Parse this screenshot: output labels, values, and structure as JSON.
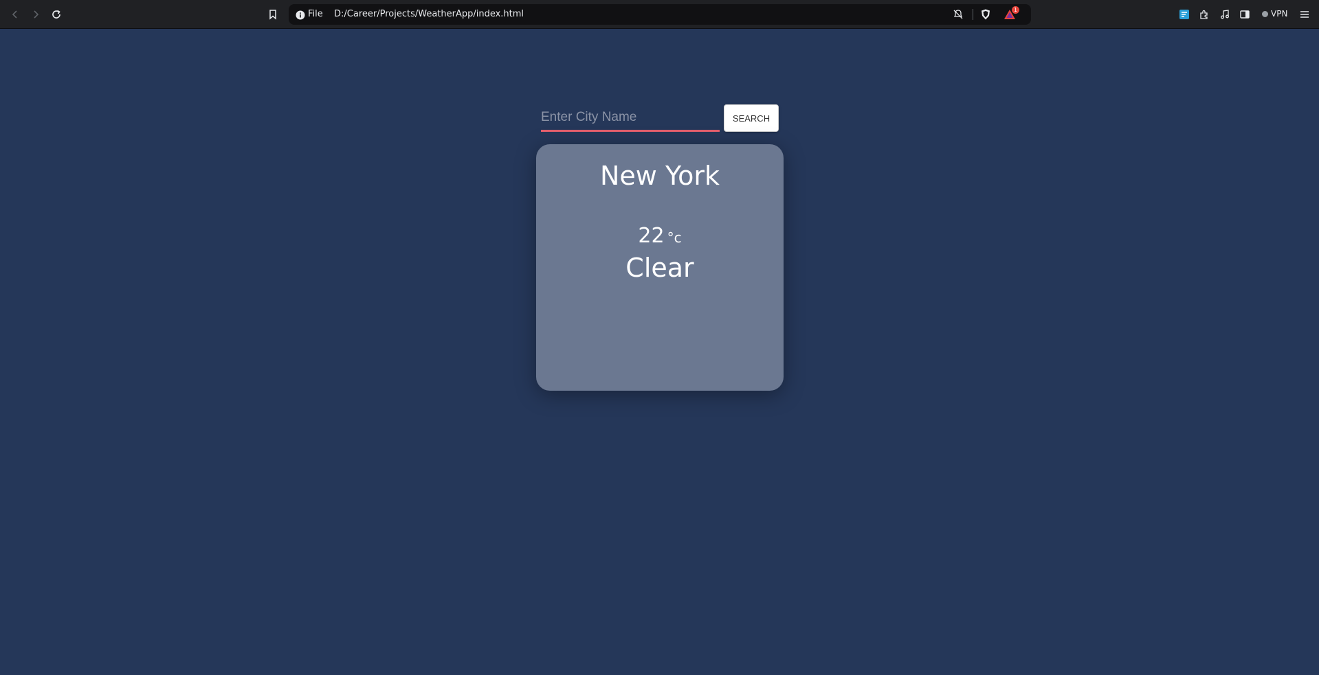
{
  "browser": {
    "address": {
      "scheme_label": "File",
      "url": "D:/Career/Projects/WeatherApp/index.html"
    },
    "rewards_badge": "1",
    "vpn_label": "VPN",
    "icons": [
      "back-icon",
      "forward-icon",
      "reload-icon",
      "bookmark-icon",
      "info-icon",
      "no-tracking-icon",
      "brave-shields-icon",
      "brave-rewards-icon",
      "extension-1-icon",
      "extensions-icon",
      "media-icon",
      "sidebar-icon",
      "vpn-icon",
      "menu-icon"
    ]
  },
  "search": {
    "placeholder": "Enter City Name",
    "value": "",
    "button_label": "SEARCH",
    "accent_color": "#e5606d"
  },
  "weather": {
    "city": "New York",
    "temperature": "22",
    "unit": "°c",
    "condition": "Clear"
  },
  "colors": {
    "page_background": "#253759",
    "card_background": "#6b7891",
    "toolbar_background": "#202124"
  }
}
